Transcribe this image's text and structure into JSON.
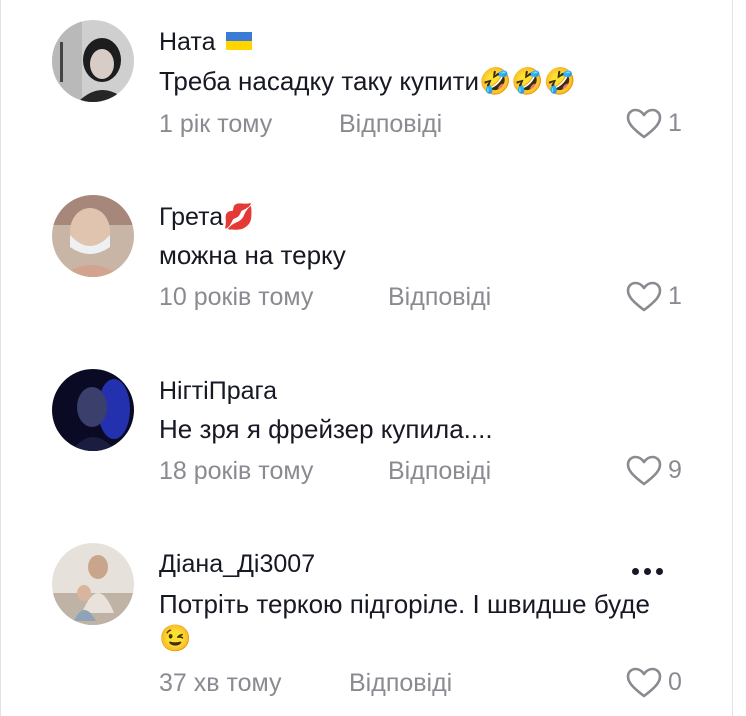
{
  "comments": [
    {
      "author": "Ната",
      "author_badge": "flag-ukraine-icon",
      "text": "Треба насадку таку купити🤣🤣🤣",
      "time": "1 рік тому",
      "reply_label": "Відповіді",
      "likes": "1"
    },
    {
      "author": "Грета💋",
      "text": "можна на терку",
      "time": "10 років тому",
      "reply_label": "Відповіді",
      "likes": "1"
    },
    {
      "author": "НігтіПрага",
      "text": "Не зря я фрейзер купила....",
      "time": "18 років тому",
      "reply_label": "Відповіді",
      "likes": "9"
    },
    {
      "author": "Діана_Ді3007",
      "text": "Потріть теркою підгоріле. І швидше буде 😉",
      "time": "37 хв тому",
      "reply_label": "Відповіді",
      "likes": "0"
    }
  ],
  "icons": {
    "like": "heart-outline-icon",
    "more": "more-options-icon"
  },
  "colors": {
    "text": "#161823",
    "meta": "#8a8b91",
    "divider": "#e3e3e4"
  }
}
